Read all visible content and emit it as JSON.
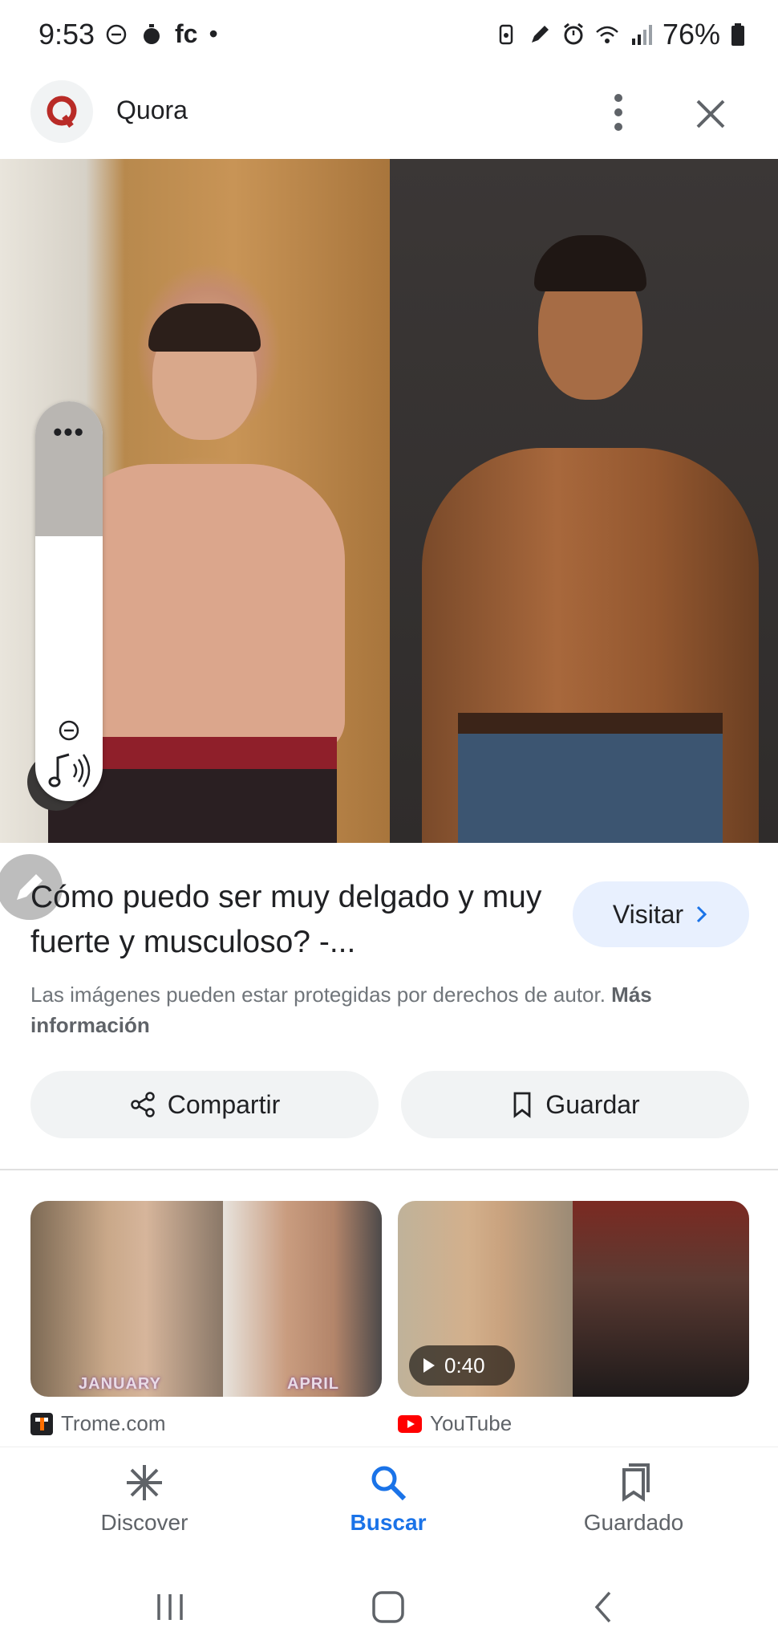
{
  "status_bar": {
    "time": "9:53",
    "left_indicators": [
      "dnd-icon",
      "stopwatch-icon",
      "fc",
      "•"
    ],
    "right_icons": [
      "battery-saver-icon",
      "pen-icon",
      "alarm-icon",
      "wifi-icon",
      "signal-icon"
    ],
    "battery": "76%"
  },
  "header": {
    "site_name": "Quora",
    "favicon_letter": "Q",
    "accent": "#b92b27"
  },
  "pill_widget": {
    "menu": "•••"
  },
  "result": {
    "title": "Cómo puedo ser muy delgado y muy fuerte y musculoso? -...",
    "visit_label": "Visitar",
    "copyright_text": "Las imágenes pueden estar protegidas por derechos de autor.",
    "more_info": "Más información"
  },
  "actions": {
    "share_label": "Compartir",
    "save_label": "Guardar"
  },
  "related": [
    {
      "source": "Trome.com",
      "captions": [
        "JANUARY",
        "APRIL"
      ]
    },
    {
      "source": "YouTube",
      "duration": "0:40"
    }
  ],
  "bottom_nav": {
    "items": [
      {
        "label": "Discover",
        "icon": "asterisk-icon"
      },
      {
        "label": "Buscar",
        "icon": "search-icon",
        "active": true
      },
      {
        "label": "Guardado",
        "icon": "bookmarks-icon"
      }
    ],
    "active_color": "#1a73e8"
  }
}
